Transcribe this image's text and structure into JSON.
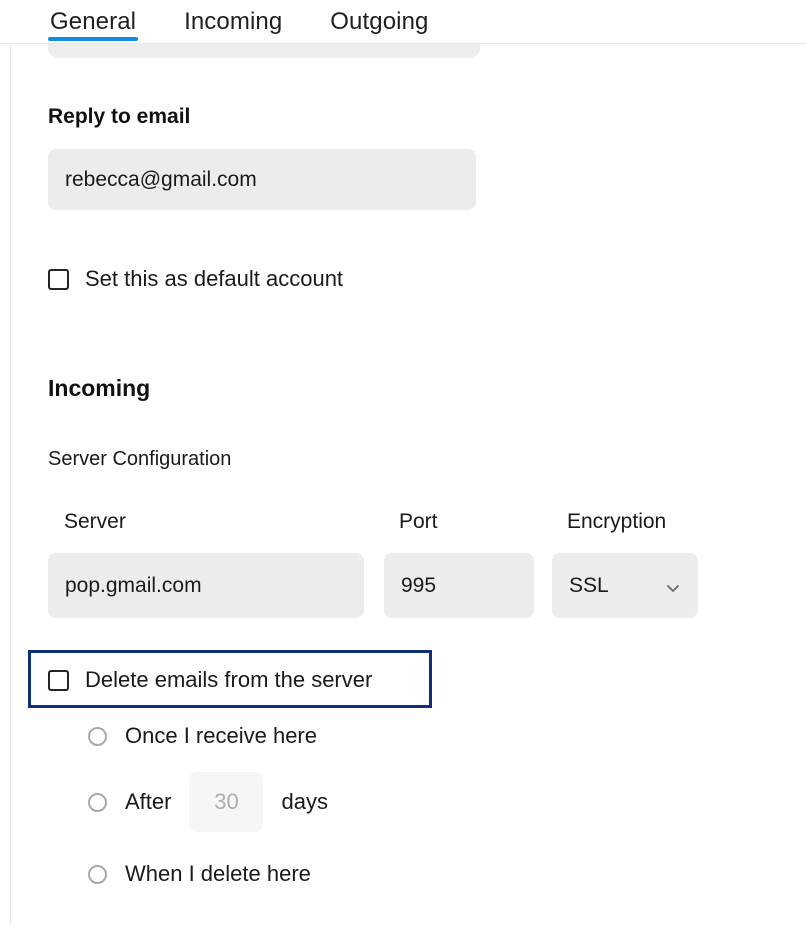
{
  "tabs": [
    {
      "label": "General",
      "active": true
    },
    {
      "label": "Incoming",
      "active": false
    },
    {
      "label": "Outgoing",
      "active": false
    }
  ],
  "general": {
    "reply_to_label": "Reply to email",
    "reply_to_value": "rebecca@gmail.com",
    "default_account_label": "Set this as default account",
    "default_account_checked": false
  },
  "incoming": {
    "heading": "Incoming",
    "server_config_label": "Server Configuration",
    "server_label": "Server",
    "server_value": "pop.gmail.com",
    "port_label": "Port",
    "port_value": "995",
    "encryption_label": "Encryption",
    "encryption_value": "SSL",
    "encryption_icon": "chevron-down-icon",
    "delete_emails_label": "Delete emails from the server",
    "delete_emails_checked": false,
    "delete_options": [
      {
        "label": "Once I receive here",
        "selected": false
      },
      {
        "label": "After",
        "selected": false,
        "suffix": "days",
        "value_placeholder": "30"
      },
      {
        "label": "When I delete here",
        "selected": false
      }
    ]
  },
  "colors": {
    "accent": "#0f8ee0",
    "focus_outline": "#0d2e78",
    "field_bg": "#ececec",
    "muted_field_bg": "#f6f6f6",
    "page_bg": "#ffffff",
    "text": "#1a1a1a"
  }
}
